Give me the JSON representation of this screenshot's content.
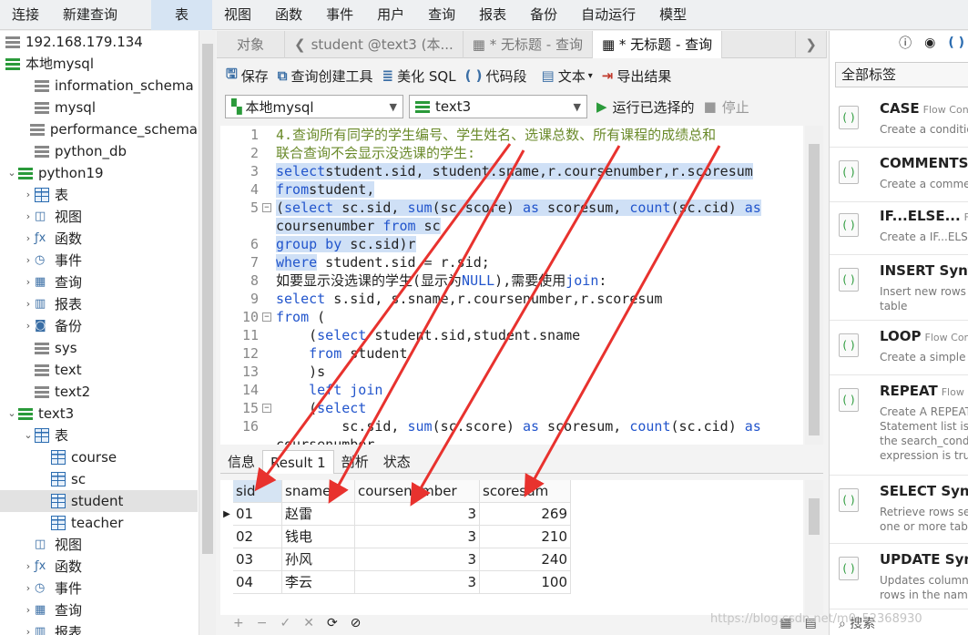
{
  "menubar": [
    "连接",
    "新建查询",
    "表",
    "视图",
    "函数",
    "事件",
    "用户",
    "查询",
    "报表",
    "备份",
    "自动运行",
    "模型"
  ],
  "tree": [
    {
      "label": "192.168.179.134",
      "icon": "server-gray-icon",
      "indent": 0,
      "arrow": ""
    },
    {
      "label": "本地mysql",
      "icon": "server-green-icon",
      "indent": 0,
      "arrow": ""
    },
    {
      "label": "information_schema",
      "icon": "database-icon",
      "indent": 1,
      "arrow": ""
    },
    {
      "label": "mysql",
      "icon": "database-icon",
      "indent": 1,
      "arrow": ""
    },
    {
      "label": "performance_schema",
      "icon": "database-icon",
      "indent": 1,
      "arrow": ""
    },
    {
      "label": "python_db",
      "icon": "database-icon",
      "indent": 1,
      "arrow": ""
    },
    {
      "label": "python19",
      "icon": "database-open-icon",
      "indent": 0,
      "arrow": "v"
    },
    {
      "label": "表",
      "icon": "table-icon",
      "indent": 1,
      "arrow": ">"
    },
    {
      "label": "视图",
      "icon": "view-icon",
      "indent": 1,
      "arrow": ">"
    },
    {
      "label": "函数",
      "icon": "function-icon",
      "indent": 1,
      "arrow": ">"
    },
    {
      "label": "事件",
      "icon": "event-icon",
      "indent": 1,
      "arrow": ">"
    },
    {
      "label": "查询",
      "icon": "query-icon",
      "indent": 1,
      "arrow": ">"
    },
    {
      "label": "报表",
      "icon": "report-icon",
      "indent": 1,
      "arrow": ">"
    },
    {
      "label": "备份",
      "icon": "backup-icon",
      "indent": 1,
      "arrow": ">"
    },
    {
      "label": "sys",
      "icon": "database-icon",
      "indent": 1,
      "arrow": ""
    },
    {
      "label": "text",
      "icon": "database-icon",
      "indent": 1,
      "arrow": ""
    },
    {
      "label": "text2",
      "icon": "database-icon",
      "indent": 1,
      "arrow": ""
    },
    {
      "label": "text3",
      "icon": "database-open-icon",
      "indent": 0,
      "arrow": "v"
    },
    {
      "label": "表",
      "icon": "table-icon",
      "indent": 1,
      "arrow": "v"
    },
    {
      "label": "course",
      "icon": "table-icon",
      "indent": 2,
      "arrow": ""
    },
    {
      "label": "sc",
      "icon": "table-icon",
      "indent": 2,
      "arrow": ""
    },
    {
      "label": "student",
      "icon": "table-icon",
      "indent": 2,
      "arrow": "",
      "selected": true
    },
    {
      "label": "teacher",
      "icon": "table-icon",
      "indent": 2,
      "arrow": ""
    },
    {
      "label": "视图",
      "icon": "view-icon",
      "indent": 1,
      "arrow": ""
    },
    {
      "label": "函数",
      "icon": "function-icon",
      "indent": 1,
      "arrow": ">"
    },
    {
      "label": "事件",
      "icon": "event-icon",
      "indent": 1,
      "arrow": ">"
    },
    {
      "label": "查询",
      "icon": "query-icon",
      "indent": 1,
      "arrow": ">"
    },
    {
      "label": "报表",
      "icon": "report-icon",
      "indent": 1,
      "arrow": ">"
    }
  ],
  "tabs": [
    "对象",
    "student @text3 (本...",
    "* 无标题 - 查询",
    "* 无标题 - 查询"
  ],
  "toolbar": {
    "save": "保存",
    "builder": "查询创建工具",
    "beautify": "美化 SQL",
    "snippet": "代码段",
    "text": "文本",
    "export": "导出结果"
  },
  "connection": "本地mysql",
  "database": "text3",
  "run": "运行已选择的",
  "stop": "停止",
  "editor": {
    "lines": [
      {
        "n": "1",
        "fold": false,
        "hl": false,
        "parts": [
          [
            "cm",
            "4.查询所有同学的学生编号、学生姓名、选课总数、所有课程的成绩总和"
          ]
        ]
      },
      {
        "n": "2",
        "fold": false,
        "hl": false,
        "parts": [
          [
            "cm",
            "联合查询不会显示没选课的学生:"
          ]
        ]
      },
      {
        "n": "3",
        "fold": false,
        "hl": true,
        "parts": [
          [
            "kw",
            "select"
          ],
          [
            "",
            "student.sid, student.sname,r.coursenumber,r.scoresum"
          ]
        ]
      },
      {
        "n": "4",
        "fold": false,
        "hl": true,
        "parts": [
          [
            "kw",
            "from"
          ],
          [
            "",
            "student,"
          ]
        ]
      },
      {
        "n": "5",
        "fold": true,
        "hl": true,
        "parts": [
          [
            "",
            "("
          ],
          [
            "kw",
            "select"
          ],
          [
            "",
            " sc.sid, "
          ],
          [
            "kw",
            "sum"
          ],
          [
            "",
            "(sc.score) "
          ],
          [
            "kw",
            "as"
          ],
          [
            "",
            " scoresum, "
          ],
          [
            "kw",
            "count"
          ],
          [
            "",
            "(sc.cid) "
          ],
          [
            "kw",
            "as"
          ]
        ]
      },
      {
        "n": "",
        "fold": false,
        "hl": true,
        "parts": [
          [
            "",
            "coursenumber "
          ],
          [
            "kw",
            "from"
          ],
          [
            "",
            " sc"
          ]
        ]
      },
      {
        "n": "6",
        "fold": false,
        "hl": true,
        "parts": [
          [
            "kw",
            "group by"
          ],
          [
            "",
            " sc.sid)r"
          ]
        ]
      },
      {
        "n": "7",
        "fold": false,
        "hl": true,
        "parts": [
          [
            "kw",
            "where"
          ],
          [
            "",
            " student.sid = r.sid;"
          ]
        ]
      },
      {
        "n": "8",
        "fold": false,
        "hl": false,
        "parts": [
          [
            "",
            "如要显示没选课的学生(显示为"
          ],
          [
            "kw",
            "NULL"
          ],
          [
            "",
            "),需要使用"
          ],
          [
            "kw",
            "join"
          ],
          [
            "",
            ":"
          ]
        ]
      },
      {
        "n": "9",
        "fold": false,
        "hl": false,
        "parts": [
          [
            "kw",
            "select"
          ],
          [
            "",
            " s.sid, s.sname,r.coursenumber,r.scoresum"
          ]
        ]
      },
      {
        "n": "10",
        "fold": true,
        "hl": false,
        "parts": [
          [
            "kw",
            "from"
          ],
          [
            "",
            " ("
          ]
        ]
      },
      {
        "n": "11",
        "fold": false,
        "hl": false,
        "parts": [
          [
            "",
            "    ("
          ],
          [
            "kw",
            "select"
          ],
          [
            "",
            " student.sid,student.sname"
          ]
        ]
      },
      {
        "n": "12",
        "fold": false,
        "hl": false,
        "parts": [
          [
            "",
            "    "
          ],
          [
            "kw",
            "from"
          ],
          [
            "",
            " student"
          ]
        ]
      },
      {
        "n": "13",
        "fold": false,
        "hl": false,
        "parts": [
          [
            "",
            "    )s"
          ]
        ]
      },
      {
        "n": "14",
        "fold": false,
        "hl": false,
        "parts": [
          [
            "",
            "    "
          ],
          [
            "kw",
            "left join"
          ]
        ]
      },
      {
        "n": "15",
        "fold": true,
        "hl": false,
        "parts": [
          [
            "",
            "    ("
          ],
          [
            "kw",
            "select"
          ]
        ]
      },
      {
        "n": "16",
        "fold": false,
        "hl": false,
        "parts": [
          [
            "",
            "        sc.sid, "
          ],
          [
            "kw",
            "sum"
          ],
          [
            "",
            "(sc.score) "
          ],
          [
            "kw",
            "as"
          ],
          [
            "",
            " scoresum, "
          ],
          [
            "kw",
            "count"
          ],
          [
            "",
            "(sc.cid) "
          ],
          [
            "kw",
            "as"
          ]
        ]
      },
      {
        "n": "",
        "fold": false,
        "hl": false,
        "parts": [
          [
            "",
            "coursenumber"
          ]
        ]
      }
    ]
  },
  "result_tabs": [
    "信息",
    "Result 1",
    "剖析",
    "状态"
  ],
  "grid": {
    "columns": [
      "sid",
      "sname",
      "coursenumber",
      "scoresum"
    ],
    "rows": [
      [
        "01",
        "赵雷",
        "3",
        "269"
      ],
      [
        "02",
        "钱电",
        "3",
        "210"
      ],
      [
        "03",
        "孙风",
        "3",
        "240"
      ],
      [
        "04",
        "李云",
        "3",
        "100"
      ]
    ]
  },
  "right": {
    "tag_select": "全部标签",
    "snippets": [
      {
        "title": "CASE",
        "type": "Flow Control",
        "desc": [
          "Create a conditional"
        ]
      },
      {
        "title": "COMMENTS",
        "type": "",
        "desc": [
          "Create a comment"
        ]
      },
      {
        "title": "IF...ELSE...",
        "type": "Flow",
        "desc": [
          "Create a IF...ELSE..."
        ]
      },
      {
        "title": "INSERT Syntax",
        "type": "",
        "desc": [
          "Insert new rows into a",
          "table"
        ]
      },
      {
        "title": "LOOP",
        "type": "Flow Control",
        "desc": [
          "Create a simple loop"
        ]
      },
      {
        "title": "REPEAT",
        "type": "Flow C",
        "desc": [
          "Create A REPEAT",
          "Statement list is repeated",
          "the search_condition",
          "expression is true"
        ]
      },
      {
        "title": "SELECT Syntax",
        "type": "",
        "desc": [
          "Retrieve rows selected",
          "one or more tables"
        ]
      },
      {
        "title": "UPDATE Syntax",
        "type": "",
        "desc": [
          "Updates columns",
          "rows in the named"
        ]
      }
    ],
    "search": "搜索"
  },
  "watermark": "https://blog.csdn.net/m0_52368930",
  "colors": {
    "keyword": "#2255cc",
    "comment": "#6a8a2a",
    "highlight": "#cfe0f6",
    "arrow": "#e8322e",
    "accent": "#2b6cb0"
  }
}
